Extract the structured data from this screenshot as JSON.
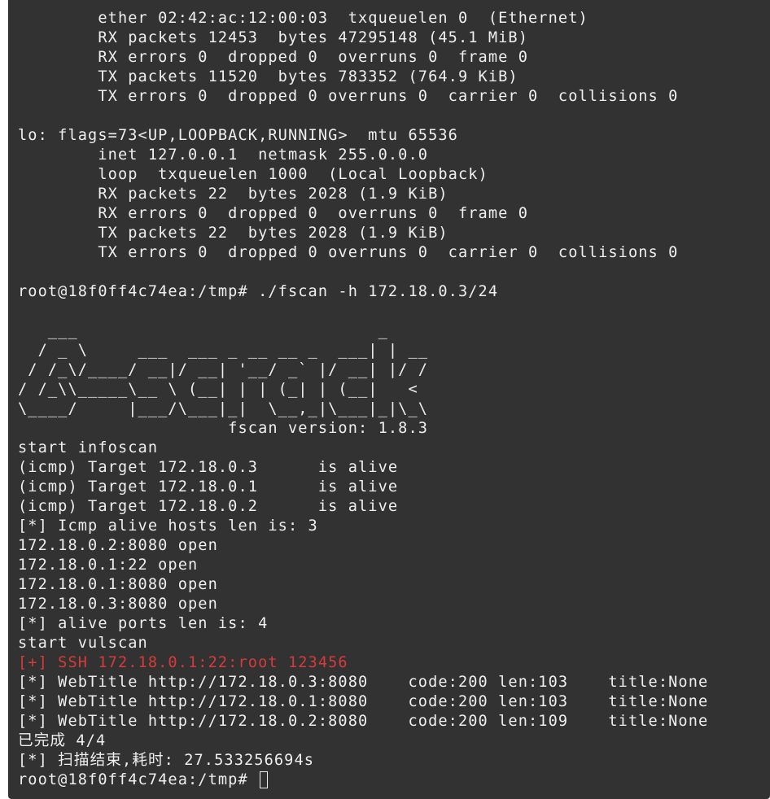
{
  "terminal": {
    "lines": [
      "        ether 02:42:ac:12:00:03  txqueuelen 0  (Ethernet)",
      "        RX packets 12453  bytes 47295148 (45.1 MiB)",
      "        RX errors 0  dropped 0  overruns 0  frame 0",
      "        TX packets 11520  bytes 783352 (764.9 KiB)",
      "        TX errors 0  dropped 0 overruns 0  carrier 0  collisions 0",
      "",
      "lo: flags=73<UP,LOOPBACK,RUNNING>  mtu 65536",
      "        inet 127.0.0.1  netmask 255.0.0.0",
      "        loop  txqueuelen 1000  (Local Loopback)",
      "        RX packets 22  bytes 2028 (1.9 KiB)",
      "        RX errors 0  dropped 0  overruns 0  frame 0",
      "        TX packets 22  bytes 2028 (1.9 KiB)",
      "        TX errors 0  dropped 0 overruns 0  carrier 0  collisions 0",
      "",
      "root@18f0ff4c74ea:/tmp# ./fscan -h 172.18.0.3/24",
      "",
      "   ___                              _",
      "  / _ \\     ___  ___ _ __ __ _  ___| | __",
      " / /_\\/____/ __|/ __| '__/ _` |/ __| |/ /",
      "/ /_\\\\_____\\__ \\ (__| | | (_| | (__|   <",
      "\\____/     |___/\\___|_|  \\__,_|\\___|_|\\_\\",
      "                     fscan version: 1.8.3",
      "start infoscan",
      "(icmp) Target 172.18.0.3      is alive",
      "(icmp) Target 172.18.0.1      is alive",
      "(icmp) Target 172.18.0.2      is alive",
      "[*] Icmp alive hosts len is: 3",
      "172.18.0.2:8080 open",
      "172.18.0.1:22 open",
      "172.18.0.1:8080 open",
      "172.18.0.3:8080 open",
      "[*] alive ports len is: 4",
      "start vulscan",
      "[+] SSH 172.18.0.1:22:root 123456",
      "[*] WebTitle http://172.18.0.3:8080    code:200 len:103    title:None",
      "[*] WebTitle http://172.18.0.1:8080    code:200 len:103    title:None",
      "[*] WebTitle http://172.18.0.2:8080    code:200 len:109    title:None",
      "已完成 4/4",
      "[*] 扫描结束,耗时: 27.533256694s",
      "root@18f0ff4c74ea:/tmp# "
    ],
    "highlight_line_index": 33,
    "colors": {
      "background": "#323232",
      "text": "#efefef",
      "highlight": "#d83a3a"
    }
  }
}
